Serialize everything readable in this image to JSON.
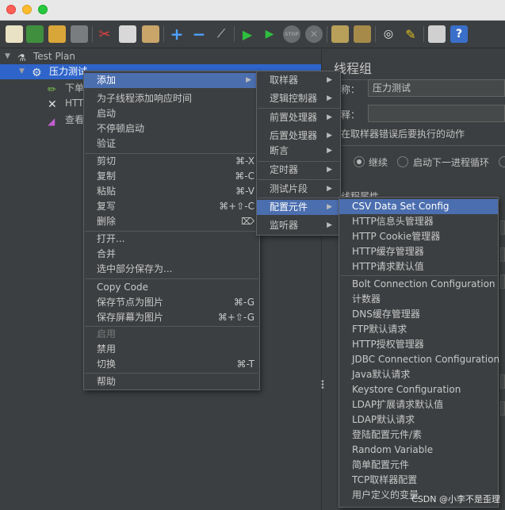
{
  "window": {
    "controls": [
      "close",
      "minimize",
      "zoom"
    ]
  },
  "toolbar": {
    "buttons": [
      "new-icon",
      "templates-icon",
      "open-icon",
      "save-icon",
      "cut-icon",
      "copy-icon",
      "paste-icon",
      "expand-icon",
      "collapse-icon",
      "toggle-icon",
      "start-icon",
      "start-no-pause-icon",
      "stop-icon",
      "shutdown-icon",
      "clear-icon",
      "clear-all-icon",
      "search-icon",
      "reset-search-icon",
      "function-helper-icon",
      "help-icon"
    ],
    "stop_label": "STOP"
  },
  "tree": {
    "root": "Test Plan",
    "thread_group": "压力测试",
    "children": [
      "下单",
      "HTTP",
      "查看"
    ]
  },
  "right_panel": {
    "title": "线程组",
    "name_label": "称：",
    "name_value": "压力测试",
    "comment_label": "释：",
    "error_action_label": "在取样器错误后要执行的动作",
    "radio_continue": "继续",
    "radio_next_loop": "启动下一进程循环",
    "thread_props_label": "线程属性"
  },
  "context_menu": {
    "items": [
      {
        "label": "添加",
        "submenu": true,
        "highlighted": true
      },
      {
        "label": "为子线程添加响应时间"
      },
      {
        "label": "启动"
      },
      {
        "label": "不停顿启动"
      },
      {
        "label": "验证"
      },
      {
        "label": "剪切",
        "shortcut": "⌘-X"
      },
      {
        "label": "复制",
        "shortcut": "⌘-C"
      },
      {
        "label": "粘贴",
        "shortcut": "⌘-V"
      },
      {
        "label": "复写",
        "shortcut": "⌘+⇧-C"
      },
      {
        "label": "删除",
        "shortcut": "⌦"
      },
      {
        "label": "打开..."
      },
      {
        "label": "合并"
      },
      {
        "label": "选中部分保存为..."
      },
      {
        "label": "Copy Code"
      },
      {
        "label": "保存节点为图片",
        "shortcut": "⌘-G"
      },
      {
        "label": "保存屏幕为图片",
        "shortcut": "⌘+⇧-G"
      },
      {
        "label": "启用",
        "disabled": true
      },
      {
        "label": "禁用"
      },
      {
        "label": "切换",
        "shortcut": "⌘-T"
      },
      {
        "label": "帮助"
      }
    ]
  },
  "add_submenu": {
    "items": [
      "取样器",
      "逻辑控制器",
      "前置处理器",
      "后置处理器",
      "断言",
      "定时器",
      "测试片段",
      "配置元件",
      "监听器"
    ],
    "highlighted": "配置元件"
  },
  "config_submenu": {
    "items": [
      "CSV Data Set Config",
      "HTTP信息头管理器",
      "HTTP Cookie管理器",
      "HTTP缓存管理器",
      "HTTP请求默认值",
      "Bolt Connection Configuration",
      "计数器",
      "DNS缓存管理器",
      "FTP默认请求",
      "HTTP授权管理器",
      "JDBC Connection Configuration",
      "Java默认请求",
      "Keystore Configuration",
      "LDAP扩展请求默认值",
      "LDAP默认请求",
      "登陆配置元件/素",
      "Random Variable",
      "简单配置元件",
      "TCP取样器配置",
      "用户定义的变量"
    ],
    "highlighted": "CSV Data Set Config"
  },
  "watermark": "CSDN @小李不是歪理"
}
